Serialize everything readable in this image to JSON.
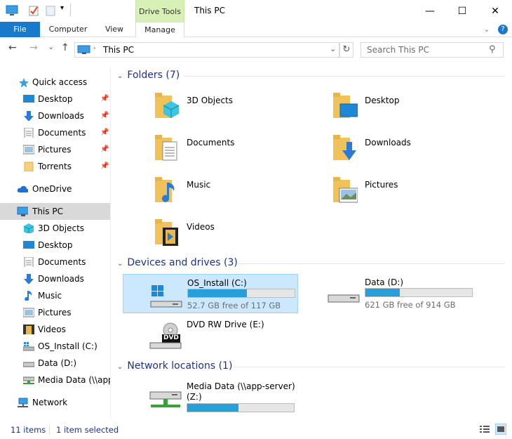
{
  "window": {
    "title": "This PC",
    "context_tab": "Drive Tools",
    "minimize": "—",
    "maximize": "☐",
    "close": "✕"
  },
  "ribbon": {
    "tabs": {
      "file": "File",
      "computer": "Computer",
      "view": "View",
      "manage": "Manage"
    },
    "collapse": "⌄",
    "help": "?"
  },
  "nav": {
    "back": "←",
    "forward": "→",
    "recent": "⌄",
    "up": "↑",
    "address": "This PC",
    "address_dropdown": "⌄",
    "refresh": "↻",
    "search_placeholder": "Search This PC",
    "search_icon": "⚲"
  },
  "sidebar": {
    "quick_access": "Quick access",
    "qa_items": [
      {
        "label": "Desktop",
        "icon": "desktop-icon"
      },
      {
        "label": "Downloads",
        "icon": "downloads-icon"
      },
      {
        "label": "Documents",
        "icon": "documents-icon"
      },
      {
        "label": "Pictures",
        "icon": "pictures-icon"
      },
      {
        "label": "Torrents",
        "icon": "folder-icon"
      }
    ],
    "onedrive": "OneDrive",
    "this_pc": "This PC",
    "pc_items": [
      {
        "label": "3D Objects"
      },
      {
        "label": "Desktop"
      },
      {
        "label": "Documents"
      },
      {
        "label": "Downloads"
      },
      {
        "label": "Music"
      },
      {
        "label": "Pictures"
      },
      {
        "label": "Videos"
      },
      {
        "label": "OS_Install (C:)"
      },
      {
        "label": "Data (D:)"
      },
      {
        "label": "Media Data (\\\\app-"
      }
    ],
    "network": "Network"
  },
  "main": {
    "folders_header": "Folders (7)",
    "folders": [
      {
        "name": "3D Objects"
      },
      {
        "name": "Desktop"
      },
      {
        "name": "Documents"
      },
      {
        "name": "Downloads"
      },
      {
        "name": "Music"
      },
      {
        "name": "Pictures"
      },
      {
        "name": "Videos"
      }
    ],
    "devices_header": "Devices and drives (3)",
    "drives": [
      {
        "name": "OS_Install (C:)",
        "free": "52.7 GB free of 117 GB",
        "used_fraction": 0.55
      },
      {
        "name": "Data (D:)",
        "free": "621 GB free of 914 GB",
        "used_fraction": 0.32
      },
      {
        "name": "DVD RW Drive (E:)",
        "badge": "DVD"
      }
    ],
    "network_header": "Network locations (1)",
    "network_locations": [
      {
        "name_line1": "Media Data (\\\\app-server)",
        "name_line2": "(Z:)",
        "used_fraction": 0.48
      }
    ]
  },
  "status": {
    "items": "11 items",
    "selected": "1 item selected"
  },
  "colors": {
    "accent": "#1979ca",
    "selection": "#cce8ff",
    "bar_fill": "#26a0da",
    "folder": "#f5c95b",
    "heading": "#1e3287"
  }
}
